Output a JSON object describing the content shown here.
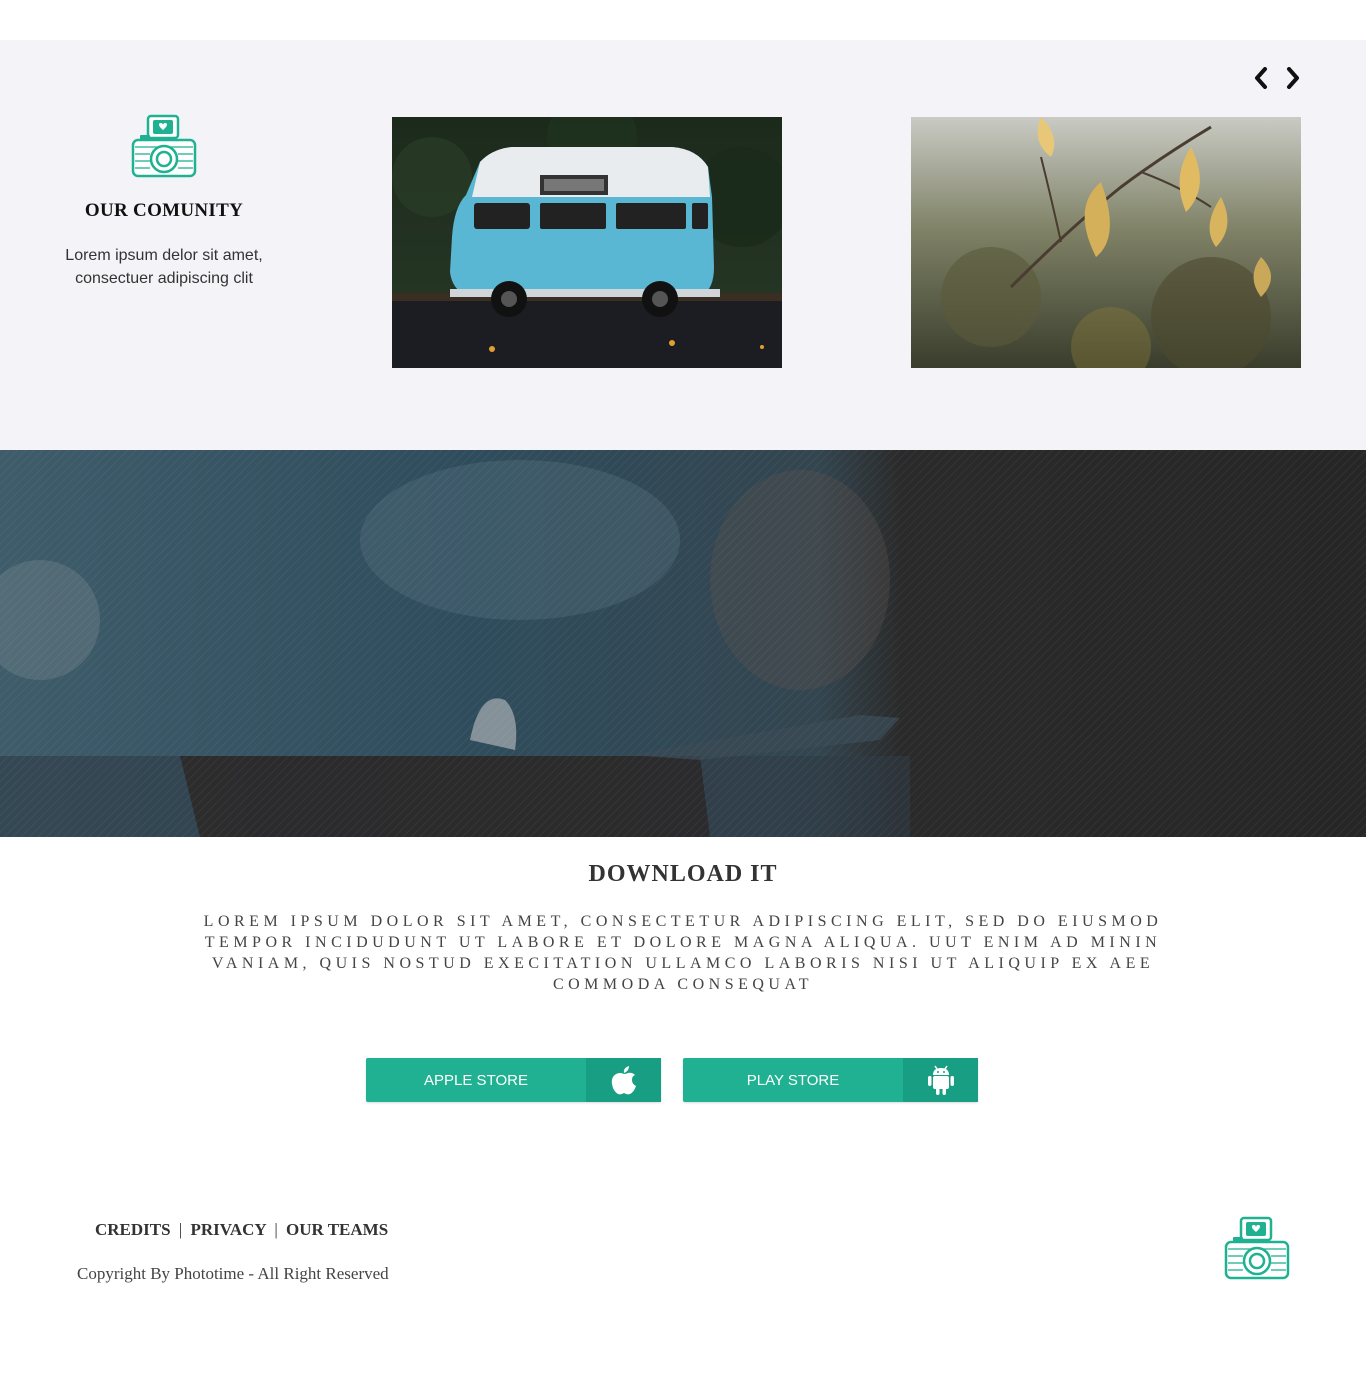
{
  "colors": {
    "accent": "#1fb191",
    "accent_dark": "#189e82",
    "section_bg": "#f4f4f8",
    "hero_dark": "#2a2a2a",
    "text_dark": "#333333"
  },
  "slider": {
    "prev_icon": "chevron-left-icon",
    "next_icon": "chevron-right-icon"
  },
  "community": {
    "icon": "camera-icon",
    "title": "OUR COMUNITY",
    "text_line1": "Lorem ipsum delor sit amet,",
    "text_line2": "consectuer adipiscing clit",
    "photos": [
      "blue-van-photo",
      "autumn-leaves-photo"
    ]
  },
  "download": {
    "title": "DOWNLOAD IT",
    "text": "LOREM IPSUM DOLOR SIT AMET, CONSECTETUR ADIPISCING ELIT, SED DO EIUSMOD TEMPOR INCIDUDUNT UT LABORE ET DOLORE MAGNA ALIQUA. UUT ENIM AD MININ VANIAM, QUIS NOSTUD EXECITATION ULLAMCO LABORIS NISI UT ALIQUIP EX AEE COMMODA CONSEQUAT",
    "apple_label": "APPLE STORE",
    "apple_icon": "apple-icon",
    "play_label": "PLAY STORE",
    "play_icon": "android-icon"
  },
  "footer": {
    "links": [
      "CREDITS",
      "PRIVACY",
      "OUR TEAMS"
    ],
    "separator": "|",
    "copyright": "Copyright By Phototime - All Right Reserved",
    "logo_icon": "camera-icon"
  }
}
